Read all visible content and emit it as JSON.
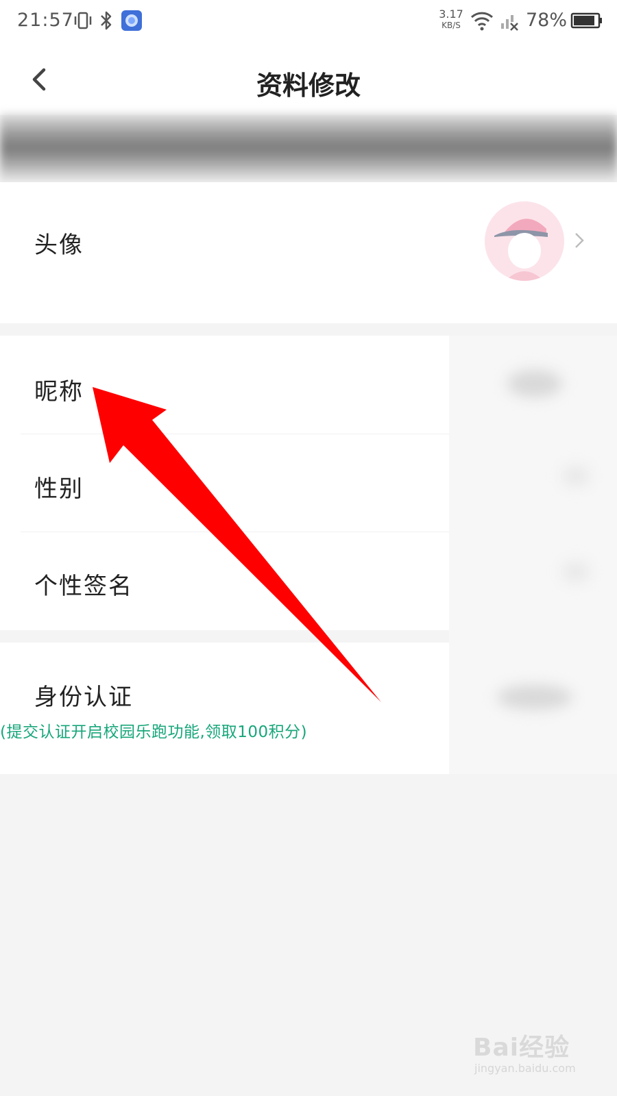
{
  "status_bar": {
    "time": "21:57",
    "net_speed_value": "3.17",
    "net_speed_unit": "KB/S",
    "battery": "78%",
    "icons": [
      "vibrate-icon",
      "bluetooth-icon",
      "app-notification-icon",
      "wifi-icon",
      "signal-off-icon",
      "battery-icon"
    ]
  },
  "header": {
    "title": "资料修改",
    "back_icon": "chevron-left-icon"
  },
  "profile": {
    "avatar_label": "头像",
    "nickname_label": "昵称",
    "gender_label": "性别",
    "signature_label": "个性签名",
    "id_verify_label": "身份认证",
    "id_verify_hint": "(提交认证开启校园乐跑功能,领取100积分)"
  },
  "annotation": {
    "arrow_color": "#ff0000",
    "points_to": "昵称"
  },
  "watermark": {
    "text": "Bai经验",
    "url": "jingyan.baidu.com"
  },
  "colors": {
    "hint_green": "#17a67a",
    "page_bg": "#f4f4f4"
  }
}
